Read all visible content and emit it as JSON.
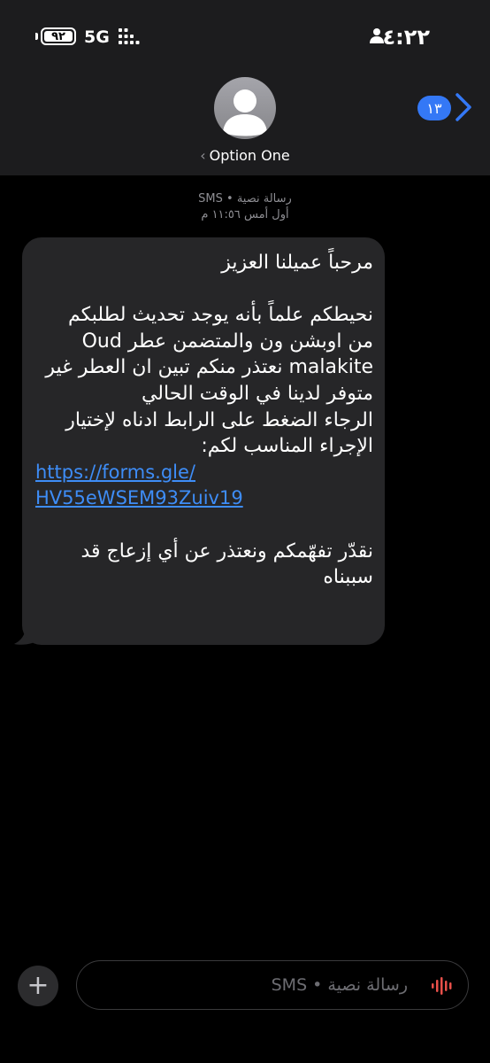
{
  "status_bar": {
    "time": "٤:٢٢",
    "network": "5G",
    "battery": "٩٢"
  },
  "header": {
    "unread_count": "١٣",
    "contact_name": "Option One",
    "contact_chevron": "‹"
  },
  "meta": {
    "service": "رسالة نصية • SMS",
    "timestamp": "أول أمس ١١:٥٦ م"
  },
  "message": {
    "line_1": "مرحباً عميلنا العزيز",
    "line_2": "نحيطكم علماً بأنه يوجد تحديث لطلبكم",
    "line_3": "من اوبشن ون والمتضمن عطر Oud",
    "line_4": "malakite نعتذر منكم تبين ان العطر غير",
    "line_5": "متوفر لدينا في الوقت الحالي",
    "line_6": "الرجاء الضغط على الرابط ادناه لإختيار",
    "line_7": "الإجراء المناسب لكم:",
    "link_line_1": "https://forms.gle/",
    "link_line_2": "HV55eWSEM93Zuiv19",
    "line_8": "نقدّر تفهّمكم ونعتذر عن أي إزعاج قد",
    "line_9": "سببناه"
  },
  "composer": {
    "plus_label": "+",
    "placeholder": "رسالة نصية • SMS"
  },
  "colors": {
    "accent_blue": "#3478f6",
    "link_blue": "#3e8df7",
    "bubble_gray": "#262628",
    "mic_red": "#e8504a"
  },
  "icons": [
    "person-icon",
    "signal-icon",
    "battery-icon",
    "chevron-right-icon",
    "avatar-silhouette-icon",
    "plus-icon",
    "waveform-mic-icon"
  ]
}
